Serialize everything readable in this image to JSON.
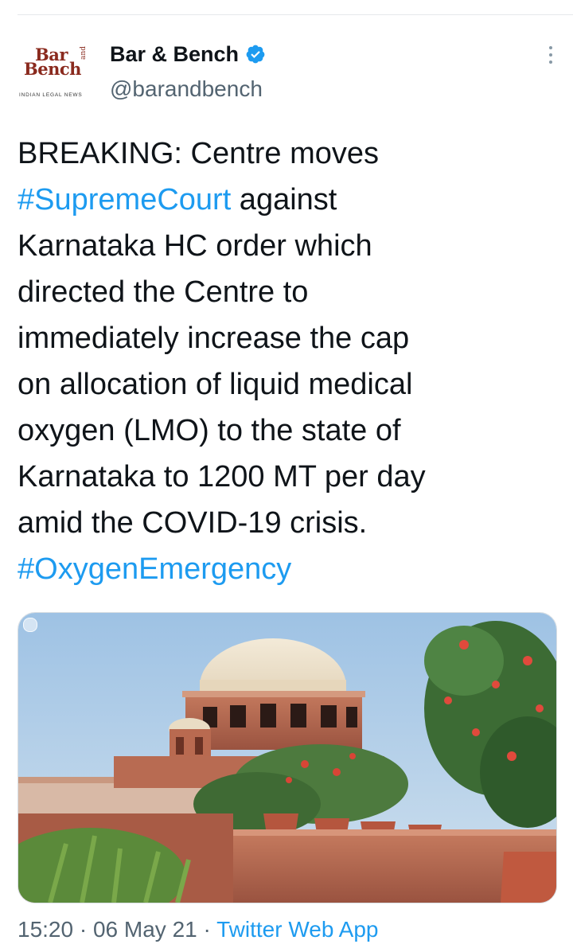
{
  "tweet": {
    "author": {
      "display_name": "Bar & Bench",
      "handle": "@barandbench",
      "verified": true,
      "avatar": {
        "line1": "Bar",
        "line2": "Bench",
        "and_mark": "and",
        "tagline": "INDIAN LEGAL NEWS"
      }
    },
    "text_lines": [
      [
        {
          "text": "BREAKING: Centre moves",
          "type": "text"
        }
      ],
      [
        {
          "text": "#SupremeCourt",
          "type": "hashtag"
        },
        {
          "text": " against",
          "type": "text"
        }
      ],
      [
        {
          "text": "Karnataka HC order which",
          "type": "text"
        }
      ],
      [
        {
          "text": "directed the Centre to",
          "type": "text"
        }
      ],
      [
        {
          "text": "immediately increase the cap",
          "type": "text"
        }
      ],
      [
        {
          "text": "on allocation of liquid medical",
          "type": "text"
        }
      ],
      [
        {
          "text": "oxygen (LMO) to the state of",
          "type": "text"
        }
      ],
      [
        {
          "text": "Karnataka to 1200 MT per day",
          "type": "text"
        }
      ],
      [
        {
          "text": "amid the COVID-19 crisis.",
          "type": "text"
        }
      ],
      [
        {
          "text": "#OxygenEmergency",
          "type": "hashtag"
        }
      ]
    ],
    "media": {
      "type": "photo"
    },
    "footer": {
      "time": "15:20",
      "separator1": " · ",
      "date": "06 May 21",
      "separator2": " · ",
      "source": "Twitter Web App"
    }
  },
  "colors": {
    "text": "#0f1419",
    "secondary": "#536471",
    "link": "#1d9bf0",
    "verified": "#1d9bf0",
    "divider": "#e5e8eb",
    "logo": "#8a2a1e"
  },
  "icons": {
    "verified": "verified-badge-icon",
    "more": "more-options-icon"
  }
}
